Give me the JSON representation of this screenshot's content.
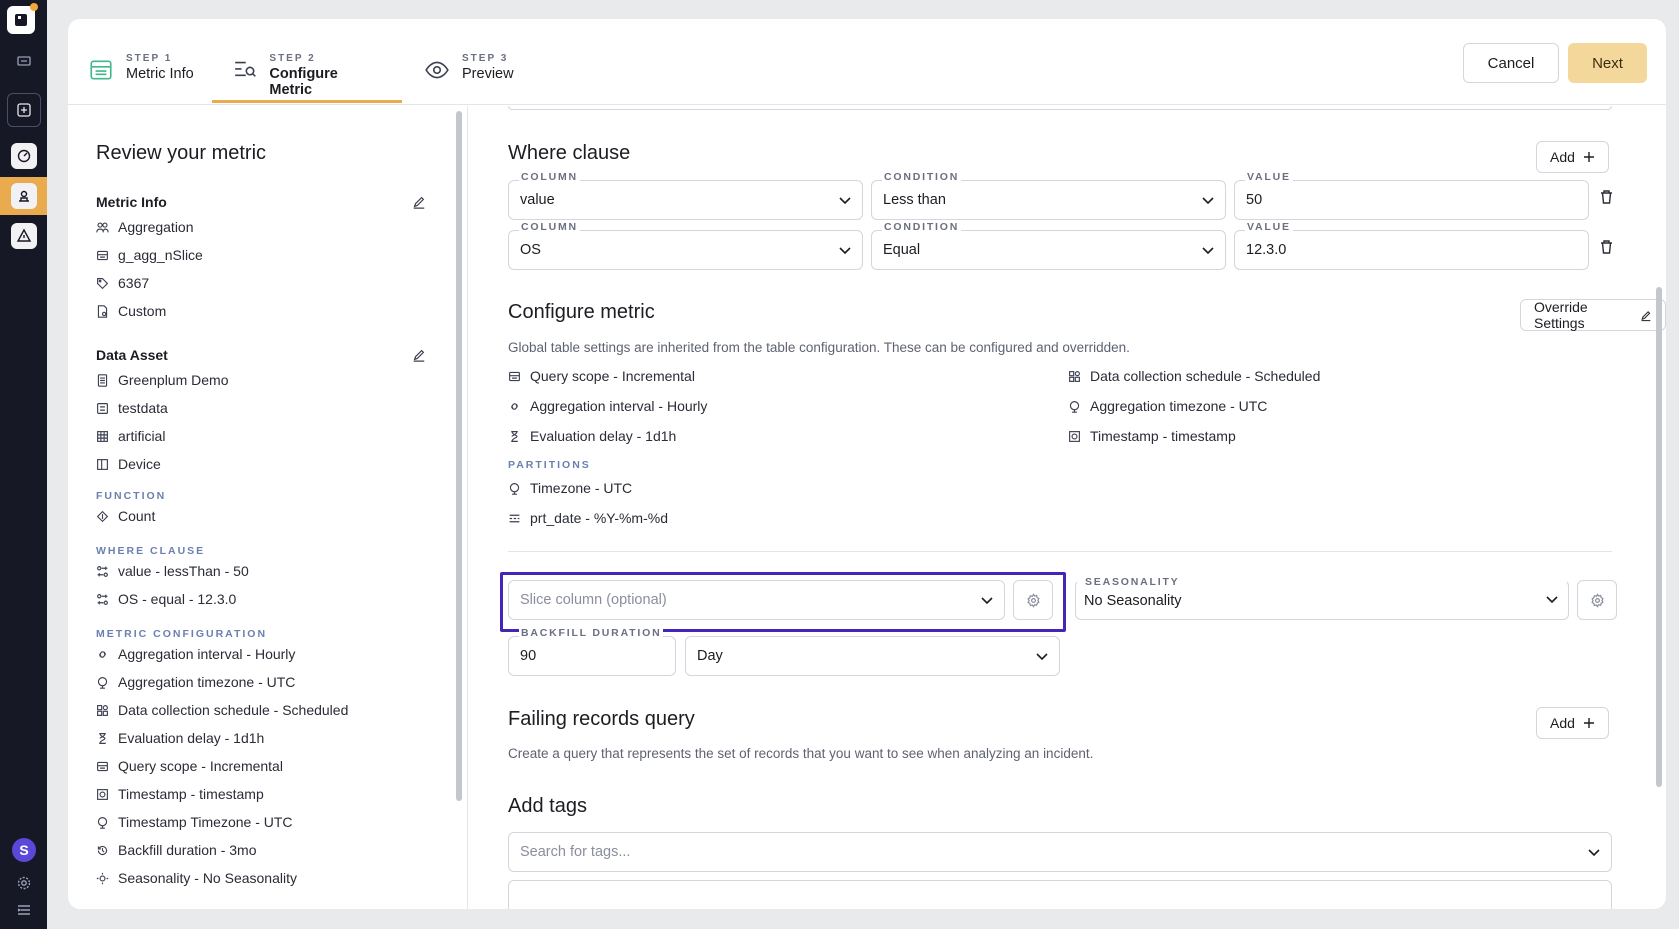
{
  "steps": [
    {
      "num": "STEP 1",
      "label": "Metric Info"
    },
    {
      "num": "STEP 2",
      "label": "Configure Metric"
    },
    {
      "num": "STEP 3",
      "label": "Preview"
    }
  ],
  "actions": {
    "cancel": "Cancel",
    "next": "Next"
  },
  "left": {
    "title": "Review your metric",
    "metric_info": {
      "heading": "Metric Info",
      "items": [
        "Aggregation",
        "g_agg_nSlice",
        "6367",
        "Custom"
      ]
    },
    "data_asset": {
      "heading": "Data Asset",
      "items": [
        "Greenplum Demo",
        "testdata",
        "artificial",
        "Device"
      ]
    },
    "function": {
      "caption": "FUNCTION",
      "items": [
        "Count"
      ]
    },
    "where_clause": {
      "caption": "WHERE CLAUSE",
      "items": [
        "value - lessThan - 50",
        "OS - equal - 12.3.0"
      ]
    },
    "metric_configuration": {
      "caption": "METRIC CONFIGURATION",
      "items": [
        "Aggregation interval - Hourly",
        "Aggregation timezone - UTC",
        "Data collection schedule - Scheduled",
        "Evaluation delay - 1d1h",
        "Query scope - Incremental",
        "Timestamp - timestamp",
        "Timestamp Timezone - UTC",
        "Backfill duration - 3mo",
        "Seasonality - No Seasonality"
      ]
    }
  },
  "where": {
    "title": "Where clause",
    "add_label": "Add",
    "rows": [
      {
        "column_label": "COLUMN",
        "column": "value",
        "condition_label": "CONDITION",
        "condition": "Less than",
        "value_label": "VALUE",
        "value": "50"
      },
      {
        "column_label": "COLUMN",
        "column": "OS",
        "condition_label": "CONDITION",
        "condition": "Equal",
        "value_label": "VALUE",
        "value": "12.3.0"
      }
    ]
  },
  "configure": {
    "title": "Configure metric",
    "override_label": "Override Settings",
    "description": "Global table settings are inherited from the table configuration. These can be configured and overridden.",
    "left_items": [
      "Query scope - Incremental",
      "Aggregation interval - Hourly",
      "Evaluation delay - 1d1h"
    ],
    "right_items": [
      "Data collection schedule - Scheduled",
      "Aggregation timezone - UTC",
      "Timestamp - timestamp"
    ],
    "partitions_caption": "PARTITIONS",
    "partition_items": [
      "Timezone - UTC",
      "prt_date - %Y-%m-%d"
    ]
  },
  "slice": {
    "placeholder": "Slice column (optional)"
  },
  "seasonality": {
    "label": "SEASONALITY",
    "value": "No Seasonality"
  },
  "backfill": {
    "label": "BACKFILL DURATION",
    "value": "90",
    "unit": "Day"
  },
  "failing": {
    "title": "Failing records query",
    "add_label": "Add",
    "description": "Create a query that represents the set of records that you want to see when analyzing an incident."
  },
  "tags": {
    "title": "Add tags",
    "placeholder": "Search for tags..."
  },
  "colors": {
    "accent": "#e9ab4d",
    "highlight": "#4524b8",
    "next_button": "#f4d79a",
    "caption": "#6a80b0"
  }
}
